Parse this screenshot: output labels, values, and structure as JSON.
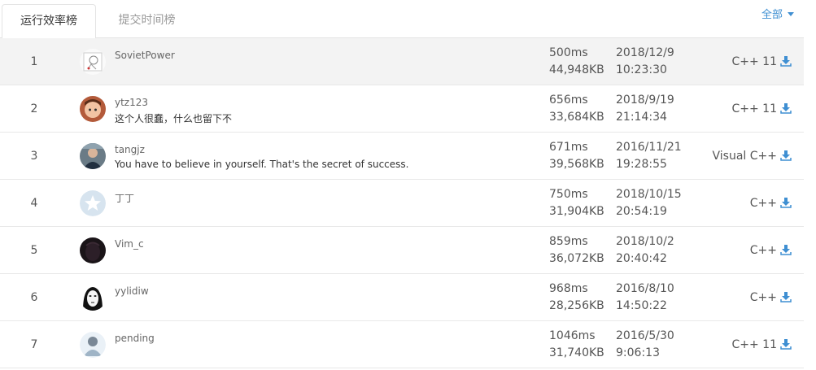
{
  "tabs": [
    {
      "label": "运行效率榜",
      "active": true
    },
    {
      "label": "提交时间榜",
      "active": false
    }
  ],
  "filter": {
    "label": "全部"
  },
  "accent_color": "#3f8fd2",
  "rows": [
    {
      "rank": "1",
      "username": "SovietPower",
      "signature": "",
      "time": "500ms",
      "memory": "44,948KB",
      "date": "2018/12/9",
      "clock": "10:23:30",
      "language": "C++ 11",
      "avatar": "sketch-avatar"
    },
    {
      "rank": "2",
      "username": "ytz123",
      "signature": "这个人很蠢，什么也留下不",
      "time": "656ms",
      "memory": "33,684KB",
      "date": "2018/9/19",
      "clock": "21:14:34",
      "language": "C++ 11",
      "avatar": "child-photo-avatar"
    },
    {
      "rank": "3",
      "username": "tangjz",
      "signature": "You have to believe in yourself. That's the secret of success.",
      "time": "671ms",
      "memory": "39,568KB",
      "date": "2016/11/21",
      "clock": "19:28:55",
      "language": "Visual C++",
      "avatar": "person-photo-avatar"
    },
    {
      "rank": "4",
      "username": "丁丁",
      "signature": "",
      "time": "750ms",
      "memory": "31,904KB",
      "date": "2018/10/15",
      "clock": "20:54:19",
      "language": "C++",
      "avatar": "default-star-avatar"
    },
    {
      "rank": "5",
      "username": "Vim_c",
      "signature": "",
      "time": "859ms",
      "memory": "36,072KB",
      "date": "2018/10/2",
      "clock": "20:40:42",
      "language": "C++",
      "avatar": "dark-avatar"
    },
    {
      "rank": "6",
      "username": "yylidiw",
      "signature": "",
      "time": "968ms",
      "memory": "28,256KB",
      "date": "2016/8/10",
      "clock": "14:50:22",
      "language": "C++",
      "avatar": "mask-avatar"
    },
    {
      "rank": "7",
      "username": "pending",
      "signature": "",
      "time": "1046ms",
      "memory": "31,740KB",
      "date": "2016/5/30",
      "clock": "9:06:13",
      "language": "C++ 11",
      "avatar": "default-person-avatar"
    }
  ]
}
